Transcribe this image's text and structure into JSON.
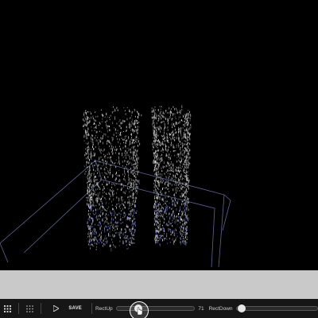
{
  "toolbar": {
    "save_label": "SAVE",
    "rect_up_label": "RectUp",
    "rect_up_value": "71",
    "rect_down_label": "RectDown",
    "rect_up_level": 0.25,
    "rect_down_level": 0.02
  },
  "icons": {
    "grid_small": "grid-icon",
    "grid_dots": "dots-grid-icon",
    "play": "play-icon",
    "hand": "hand-cursor-icon"
  },
  "colors": {
    "background": "#000000",
    "band": "#c9c9c9",
    "toolbar": "#161616",
    "wireframe": "#9aa6ff"
  }
}
